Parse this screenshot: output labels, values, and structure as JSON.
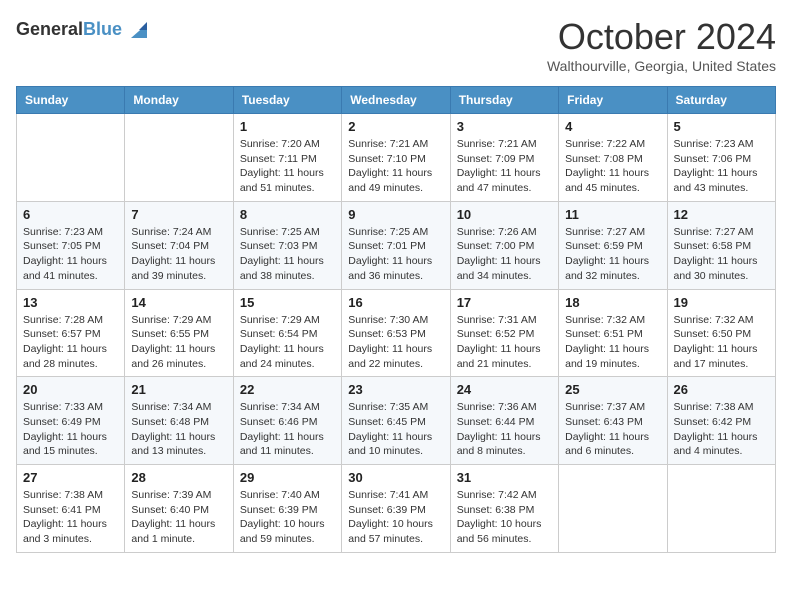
{
  "header": {
    "logo_general": "General",
    "logo_blue": "Blue",
    "month_title": "October 2024",
    "location": "Walthourville, Georgia, United States"
  },
  "days_of_week": [
    "Sunday",
    "Monday",
    "Tuesday",
    "Wednesday",
    "Thursday",
    "Friday",
    "Saturday"
  ],
  "weeks": [
    [
      {
        "day": "",
        "info": ""
      },
      {
        "day": "",
        "info": ""
      },
      {
        "day": "1",
        "info": "Sunrise: 7:20 AM\nSunset: 7:11 PM\nDaylight: 11 hours and 51 minutes."
      },
      {
        "day": "2",
        "info": "Sunrise: 7:21 AM\nSunset: 7:10 PM\nDaylight: 11 hours and 49 minutes."
      },
      {
        "day": "3",
        "info": "Sunrise: 7:21 AM\nSunset: 7:09 PM\nDaylight: 11 hours and 47 minutes."
      },
      {
        "day": "4",
        "info": "Sunrise: 7:22 AM\nSunset: 7:08 PM\nDaylight: 11 hours and 45 minutes."
      },
      {
        "day": "5",
        "info": "Sunrise: 7:23 AM\nSunset: 7:06 PM\nDaylight: 11 hours and 43 minutes."
      }
    ],
    [
      {
        "day": "6",
        "info": "Sunrise: 7:23 AM\nSunset: 7:05 PM\nDaylight: 11 hours and 41 minutes."
      },
      {
        "day": "7",
        "info": "Sunrise: 7:24 AM\nSunset: 7:04 PM\nDaylight: 11 hours and 39 minutes."
      },
      {
        "day": "8",
        "info": "Sunrise: 7:25 AM\nSunset: 7:03 PM\nDaylight: 11 hours and 38 minutes."
      },
      {
        "day": "9",
        "info": "Sunrise: 7:25 AM\nSunset: 7:01 PM\nDaylight: 11 hours and 36 minutes."
      },
      {
        "day": "10",
        "info": "Sunrise: 7:26 AM\nSunset: 7:00 PM\nDaylight: 11 hours and 34 minutes."
      },
      {
        "day": "11",
        "info": "Sunrise: 7:27 AM\nSunset: 6:59 PM\nDaylight: 11 hours and 32 minutes."
      },
      {
        "day": "12",
        "info": "Sunrise: 7:27 AM\nSunset: 6:58 PM\nDaylight: 11 hours and 30 minutes."
      }
    ],
    [
      {
        "day": "13",
        "info": "Sunrise: 7:28 AM\nSunset: 6:57 PM\nDaylight: 11 hours and 28 minutes."
      },
      {
        "day": "14",
        "info": "Sunrise: 7:29 AM\nSunset: 6:55 PM\nDaylight: 11 hours and 26 minutes."
      },
      {
        "day": "15",
        "info": "Sunrise: 7:29 AM\nSunset: 6:54 PM\nDaylight: 11 hours and 24 minutes."
      },
      {
        "day": "16",
        "info": "Sunrise: 7:30 AM\nSunset: 6:53 PM\nDaylight: 11 hours and 22 minutes."
      },
      {
        "day": "17",
        "info": "Sunrise: 7:31 AM\nSunset: 6:52 PM\nDaylight: 11 hours and 21 minutes."
      },
      {
        "day": "18",
        "info": "Sunrise: 7:32 AM\nSunset: 6:51 PM\nDaylight: 11 hours and 19 minutes."
      },
      {
        "day": "19",
        "info": "Sunrise: 7:32 AM\nSunset: 6:50 PM\nDaylight: 11 hours and 17 minutes."
      }
    ],
    [
      {
        "day": "20",
        "info": "Sunrise: 7:33 AM\nSunset: 6:49 PM\nDaylight: 11 hours and 15 minutes."
      },
      {
        "day": "21",
        "info": "Sunrise: 7:34 AM\nSunset: 6:48 PM\nDaylight: 11 hours and 13 minutes."
      },
      {
        "day": "22",
        "info": "Sunrise: 7:34 AM\nSunset: 6:46 PM\nDaylight: 11 hours and 11 minutes."
      },
      {
        "day": "23",
        "info": "Sunrise: 7:35 AM\nSunset: 6:45 PM\nDaylight: 11 hours and 10 minutes."
      },
      {
        "day": "24",
        "info": "Sunrise: 7:36 AM\nSunset: 6:44 PM\nDaylight: 11 hours and 8 minutes."
      },
      {
        "day": "25",
        "info": "Sunrise: 7:37 AM\nSunset: 6:43 PM\nDaylight: 11 hours and 6 minutes."
      },
      {
        "day": "26",
        "info": "Sunrise: 7:38 AM\nSunset: 6:42 PM\nDaylight: 11 hours and 4 minutes."
      }
    ],
    [
      {
        "day": "27",
        "info": "Sunrise: 7:38 AM\nSunset: 6:41 PM\nDaylight: 11 hours and 3 minutes."
      },
      {
        "day": "28",
        "info": "Sunrise: 7:39 AM\nSunset: 6:40 PM\nDaylight: 11 hours and 1 minute."
      },
      {
        "day": "29",
        "info": "Sunrise: 7:40 AM\nSunset: 6:39 PM\nDaylight: 10 hours and 59 minutes."
      },
      {
        "day": "30",
        "info": "Sunrise: 7:41 AM\nSunset: 6:39 PM\nDaylight: 10 hours and 57 minutes."
      },
      {
        "day": "31",
        "info": "Sunrise: 7:42 AM\nSunset: 6:38 PM\nDaylight: 10 hours and 56 minutes."
      },
      {
        "day": "",
        "info": ""
      },
      {
        "day": "",
        "info": ""
      }
    ]
  ]
}
